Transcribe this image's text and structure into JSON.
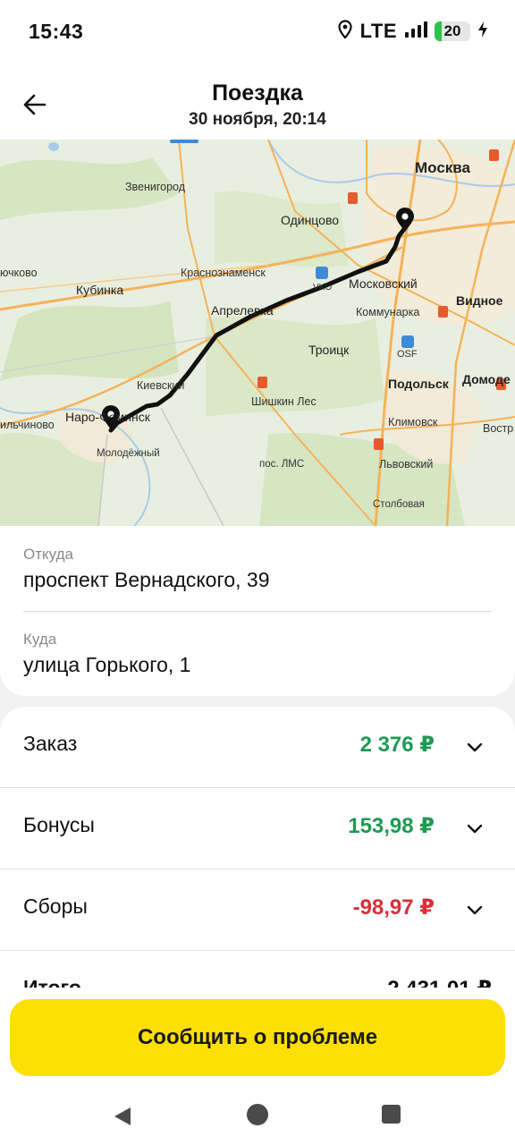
{
  "status_bar": {
    "time": "15:43",
    "network": "LTE",
    "battery": "20",
    "icons": [
      "location-icon",
      "signal-icon",
      "battery-icon",
      "charging-icon"
    ]
  },
  "header": {
    "title": "Поездка",
    "subtitle": "30 ноября, 20:14",
    "back_icon": "arrow-left-icon"
  },
  "map": {
    "labels": {
      "moskva": "Москва",
      "zvenigorod": "Звенигород",
      "odintsovo": "Одинцово",
      "chkovo": "ючково",
      "kubinka": "Кубинка",
      "krasnoznamensk": "Краснознаменск",
      "moskovsky": "Московский",
      "vidnoe": "Видное",
      "aprelevka": "Апрелевка",
      "kommunarka": "Коммунарка",
      "troitsk": "Троицк",
      "osf": "OSF",
      "vko": "VKO",
      "kievsky": "Киевский",
      "podolsk": "Подольск",
      "domodedovo": "Домоде",
      "naro": "Наро-Фоминск",
      "shishkin": "Шишкин Лес",
      "klimovsk": "Климовск",
      "vostr": "Востр",
      "ilchinovo": "ильчиново",
      "molodezhny": "Молодёжный",
      "lms": "пос. ЛМС",
      "lvovsky": "Львовский",
      "stolbovaya": "Столбовая"
    }
  },
  "route": {
    "from_label": "Откуда",
    "from_value": "проспект Вернадского, 39",
    "to_label": "Куда",
    "to_value": "улица Горького, 1"
  },
  "pricing": {
    "rows": [
      {
        "label": "Заказ",
        "value": "2 376 ₽"
      },
      {
        "label": "Бонусы",
        "value": "153,98 ₽"
      },
      {
        "label": "Сборы",
        "value": "-98,97 ₽"
      }
    ],
    "total_label": "Итого",
    "total_value": "2 431,01 ₽",
    "colors": {
      "positive": "#1f9a52",
      "negative": "#d8303a"
    }
  },
  "actions": {
    "report_problem": "Сообщить о проблеме",
    "button_color": "#fcdf03"
  },
  "nav_bar": {
    "icons": [
      "nav-back-icon",
      "nav-home-icon",
      "nav-recents-icon"
    ]
  }
}
